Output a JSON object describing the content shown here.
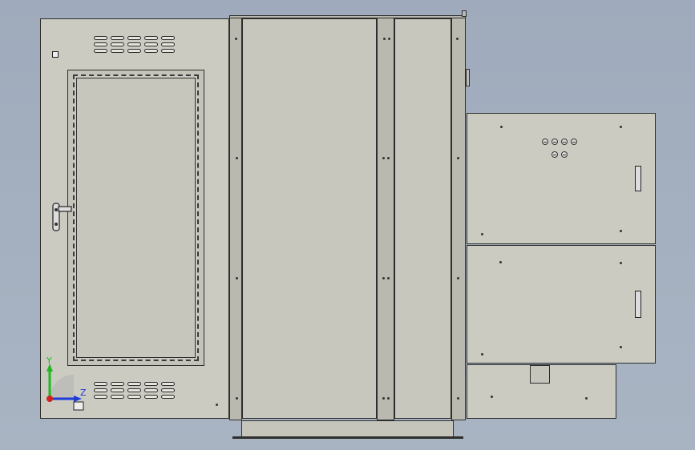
{
  "viewport": {
    "background": "#a9b4c3",
    "cabinet_color": "#cbcbc2",
    "edge_color": "#2d2d2d"
  },
  "triad": {
    "x_axis_color": "#1e3bd6",
    "y_axis_color": "#1fb81f",
    "z_axis_color": "#1e3bd6",
    "y_label": "Y",
    "z_label": "Z"
  },
  "cabinet": {
    "left_door": {
      "has_window": true,
      "handle": "latch-handle"
    },
    "right_modules": {
      "upper_screws": 6,
      "lower_modules": 2
    }
  }
}
